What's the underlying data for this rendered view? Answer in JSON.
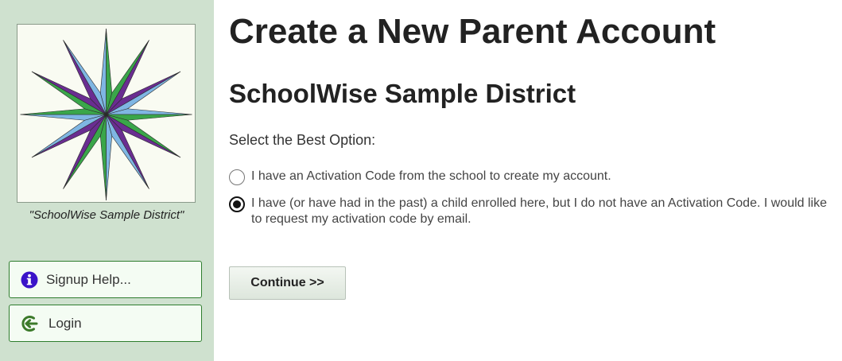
{
  "sidebar": {
    "logo_caption": "\"SchoolWise Sample District\"",
    "buttons": [
      {
        "label": "Signup Help...",
        "icon": "info-icon",
        "icon_color": "#3a13c9"
      },
      {
        "label": "Login",
        "icon": "login-icon",
        "icon_color": "#3c7a2a"
      }
    ],
    "background_color": "#cfe1cf"
  },
  "main": {
    "page_title": "Create a New Parent Account",
    "district_title": "SchoolWise Sample District",
    "prompt": "Select the Best Option:",
    "options": [
      {
        "label": "I have an Activation Code from the school to create my account.",
        "selected": false
      },
      {
        "label": "I have (or have had in the past) a child enrolled here, but I do not have an Activation Code. I would like to request my activation code by email.",
        "selected": true
      }
    ],
    "continue_label": "Continue >>"
  },
  "colors": {
    "star_purple": "#6a2d91",
    "star_blue": "#7fb6e3",
    "star_green": "#3aa64a"
  }
}
